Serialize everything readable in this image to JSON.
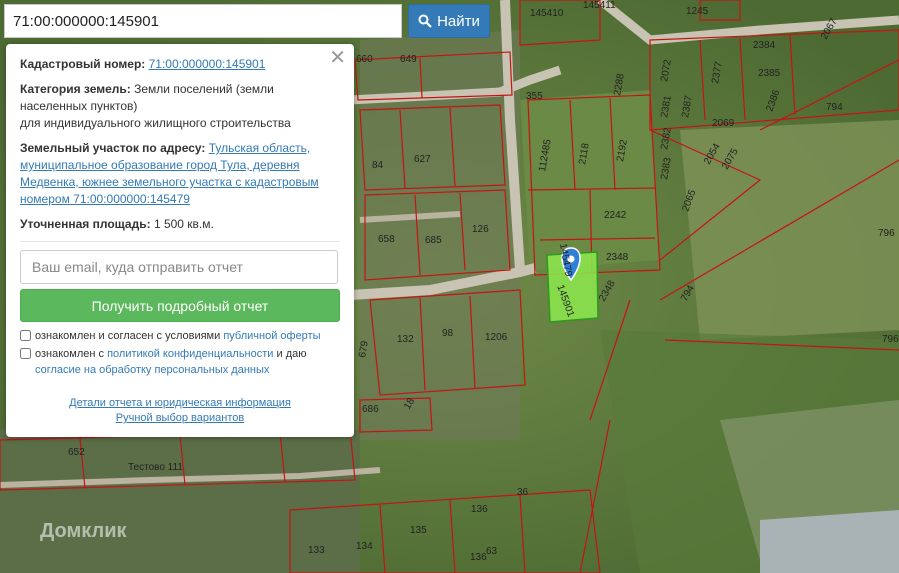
{
  "search": {
    "value": "71:00:000000:145901",
    "button_label": "Найти"
  },
  "panel": {
    "close_label": "✕",
    "cadastral_label": "Кадастровый номер:",
    "cadastral_value": "71:00:000000:145901",
    "category_label": "Категория земель:",
    "category_value": "Земли поселений (земли населенных пунктов)",
    "category_use": "для индивидуального жилищного строительства",
    "address_label": "Земельный участок по адресу:",
    "address_value": "Тульская область, муниципальное образование город Тула, деревня Медвенка, южнее земельного участка с кадастровым номером 71:00:000000:145479",
    "area_label": "Уточненная площадь:",
    "area_value": "1 500 кв.м.",
    "email_placeholder": "Ваш email, куда отправить отчет",
    "report_button": "Получить подробный отчет",
    "consent1_text": "ознакомлен и согласен с условиями",
    "consent1_link": "публичной оферты",
    "consent2_text1": "ознакомлен с",
    "consent2_link1": "политикой конфиденциальности",
    "consent2_text2": "и даю",
    "consent2_link2": "согласие на обработку персональных данных",
    "details_link": "Детали отчета и юридическая информация",
    "manual_link": "Ручной выбор вариантов"
  },
  "map": {
    "selected_parcel": "145901",
    "watermark": "Домклик",
    "parcel_labels": [
      "145410",
      "145411",
      "1245",
      "2384",
      "2067",
      "2385",
      "2072",
      "2377",
      "2386",
      "794",
      "2381",
      "2387",
      "2288",
      "2382",
      "2069",
      "112485",
      "2118",
      "2192",
      "2383",
      "2054",
      "2075",
      "2065",
      "145479",
      "2242",
      "2348",
      "2348",
      "794",
      "796",
      "796",
      "660",
      "649",
      "355",
      "84",
      "627",
      "658",
      "685",
      "126",
      "132",
      "98",
      "1206",
      "679",
      "18",
      "686",
      "652",
      "136",
      "36",
      "135",
      "133",
      "134",
      "136",
      "63"
    ],
    "road_label": "Тестово 111"
  }
}
